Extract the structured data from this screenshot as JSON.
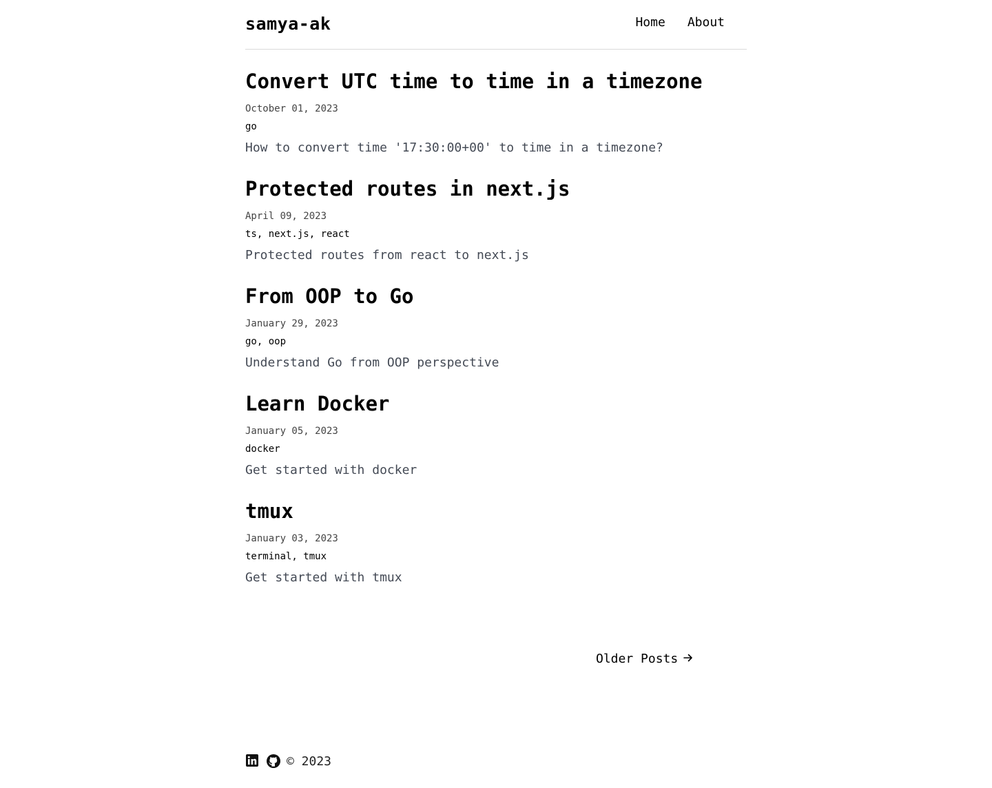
{
  "header": {
    "site_title": "samya-ak",
    "nav": [
      {
        "label": "Home"
      },
      {
        "label": "About"
      }
    ]
  },
  "posts": [
    {
      "title": "Convert UTC time to time in a timezone",
      "date": "October 01, 2023",
      "tags": "go",
      "description": "How to convert time '17:30:00+00' to time in a timezone?"
    },
    {
      "title": "Protected routes in next.js",
      "date": "April 09, 2023",
      "tags": "ts, next.js, react",
      "description": "Protected routes from react to next.js"
    },
    {
      "title": "From OOP to Go",
      "date": "January 29, 2023",
      "tags": "go, oop",
      "description": "Understand Go from OOP perspective"
    },
    {
      "title": "Learn Docker",
      "date": "January 05, 2023",
      "tags": "docker",
      "description": "Get started with docker"
    },
    {
      "title": "tmux",
      "date": "January 03, 2023",
      "tags": "terminal, tmux",
      "description": "Get started with tmux"
    }
  ],
  "pagination": {
    "older_label": "Older Posts",
    "arrow_icon": "arrow-right-icon"
  },
  "footer": {
    "icons": [
      "linkedin-icon",
      "github-icon"
    ],
    "copyright": "© 2023"
  }
}
